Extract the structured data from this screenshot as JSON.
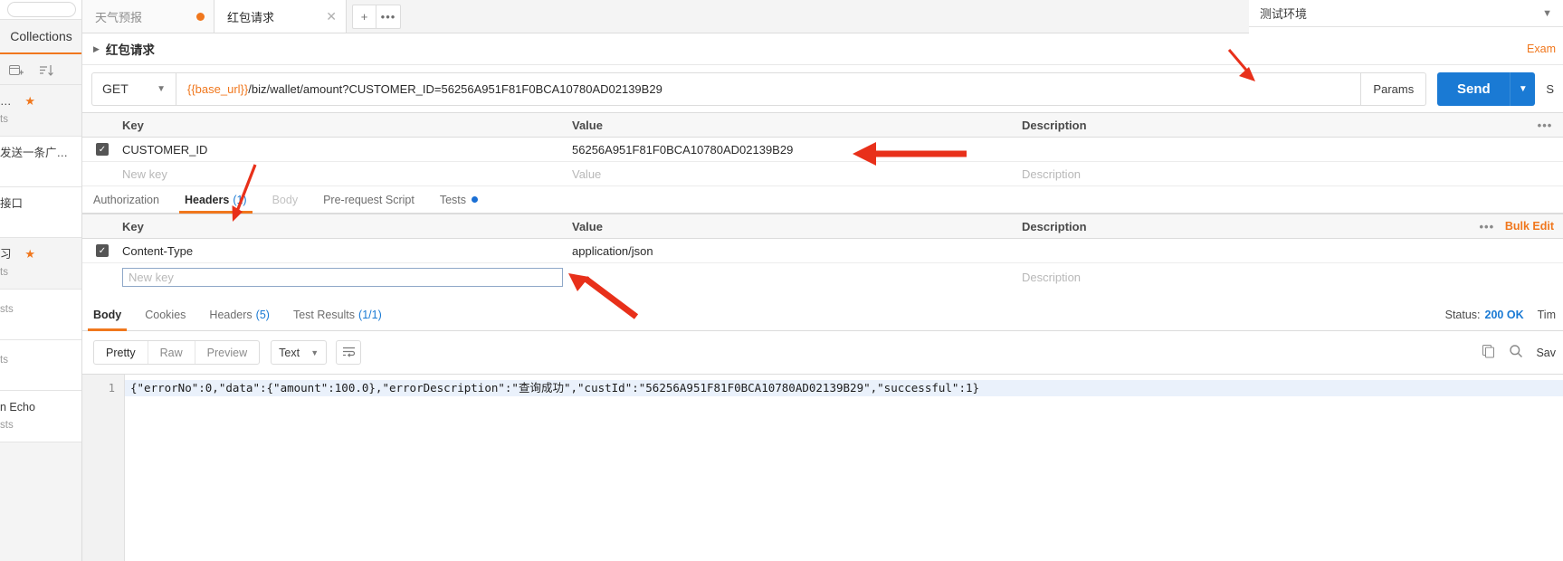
{
  "sidebar": {
    "title": "Collections",
    "search_placeholder": "",
    "new_collection_icon": "new-collection-icon",
    "sort_icon": "sort-icon",
    "items": [
      {
        "title": "…",
        "meta": "ts",
        "star": true
      },
      {
        "title": "发送一条广…",
        "meta": "",
        "star": false
      },
      {
        "title": "接口",
        "meta": "",
        "star": false
      },
      {
        "title": "习",
        "meta": "ts",
        "star": true
      },
      {
        "title": "",
        "meta": "sts",
        "star": false
      },
      {
        "title": "",
        "meta": "ts",
        "star": false
      },
      {
        "title": "n Echo",
        "meta": "sts",
        "star": false
      }
    ]
  },
  "environment": {
    "name": "测试环境",
    "chevron": "chevron-down-icon"
  },
  "tabs": {
    "items": [
      {
        "title": "天气预报",
        "active": false,
        "unsaved": true
      },
      {
        "title": "红包请求",
        "active": true,
        "unsaved": false
      }
    ],
    "new_tab_label": "+",
    "more_label": "•••"
  },
  "request": {
    "name": "红包请求",
    "examples_label": "Exam",
    "method": "GET",
    "url_variable": "{{base_url}}",
    "url_path": "/biz/wallet/amount?CUSTOMER_ID=56256A951F81F0BCA10780AD02139B29",
    "params_label": "Params",
    "send_label": "Send",
    "save_label": "S"
  },
  "params_table": {
    "columns": {
      "key": "Key",
      "value": "Value",
      "description": "Description"
    },
    "more_label": "•••",
    "rows": [
      {
        "checked": true,
        "key": "CUSTOMER_ID",
        "value": "56256A951F81F0BCA10780AD02139B29",
        "description": ""
      }
    ],
    "new_row": {
      "key_placeholder": "New key",
      "value_placeholder": "Value",
      "description_placeholder": "Description"
    }
  },
  "request_subtabs": [
    {
      "label": "Authorization",
      "count": "",
      "active": false,
      "dim": false,
      "dot": false
    },
    {
      "label": "Headers",
      "count": "(1)",
      "active": true,
      "dim": false,
      "dot": false
    },
    {
      "label": "Body",
      "count": "",
      "active": false,
      "dim": true,
      "dot": false
    },
    {
      "label": "Pre-request Script",
      "count": "",
      "active": false,
      "dim": false,
      "dot": false
    },
    {
      "label": "Tests",
      "count": "",
      "active": false,
      "dim": false,
      "dot": true
    }
  ],
  "headers_table": {
    "columns": {
      "key": "Key",
      "value": "Value",
      "description": "Description"
    },
    "more_label": "•••",
    "bulk_edit_label": "Bulk Edit",
    "rows": [
      {
        "checked": true,
        "key": "Content-Type",
        "value": "application/json",
        "description": ""
      }
    ],
    "new_row": {
      "key_placeholder": "New key",
      "value_placeholder": "",
      "description_placeholder": "Description"
    }
  },
  "response": {
    "tabs": [
      {
        "label": "Body",
        "count": "",
        "active": true
      },
      {
        "label": "Cookies",
        "count": "",
        "active": false
      },
      {
        "label": "Headers",
        "count": "(5)",
        "active": false
      },
      {
        "label": "Test Results",
        "count": "(1/1)",
        "active": false
      }
    ],
    "status_label": "Status:",
    "status_value": "200 OK",
    "time_label": "Tim",
    "view_modes": [
      {
        "label": "Pretty",
        "active": true
      },
      {
        "label": "Raw",
        "active": false
      },
      {
        "label": "Preview",
        "active": false
      }
    ],
    "format": "Text",
    "format_chevron": "chevron-down-icon",
    "wrap_icon": "wrap-lines-icon",
    "copy_icon": "copy-icon",
    "search_icon": "search-icon",
    "save_label": "Sav",
    "line_number": "1",
    "body_text": "{\"errorNo\":0,\"data\":{\"amount\":100.0},\"errorDescription\":\"查询成功\",\"custId\":\"56256A951F81F0BCA10780AD02139B29\",\"successful\":1}"
  },
  "colors": {
    "accent_orange": "#f0771d",
    "send_blue": "#1a7ad4",
    "link_blue": "#1a7ad4",
    "annotation_red": "#e8301a"
  }
}
